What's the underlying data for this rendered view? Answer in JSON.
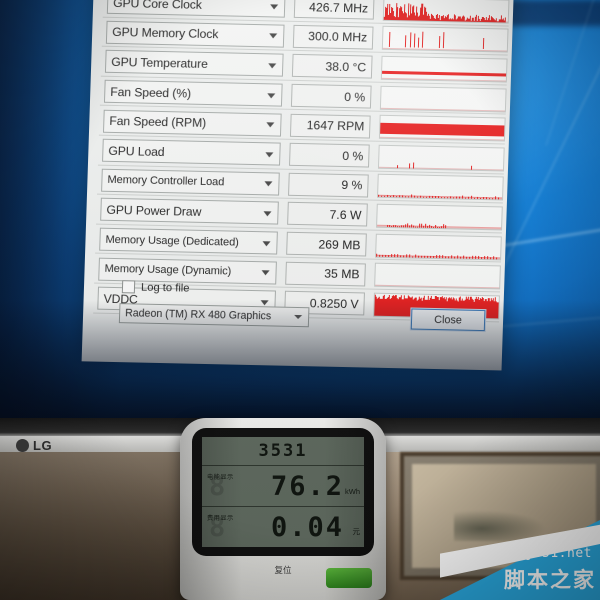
{
  "scene": {
    "monitor_brand": "LG",
    "watermark_latin": "jb51.net",
    "watermark_cn": "脚本之家"
  },
  "dialog": {
    "rows": [
      {
        "name": "GPU Core Clock",
        "value": "426.7 MHz",
        "graph": "spiky"
      },
      {
        "name": "GPU Memory Clock",
        "value": "300.0 MHz",
        "graph": "sparse"
      },
      {
        "name": "GPU Temperature",
        "value": "38.0 °C",
        "graph": "line-high"
      },
      {
        "name": "Fan Speed (%)",
        "value": "0 %",
        "graph": "empty"
      },
      {
        "name": "Fan Speed (RPM)",
        "value": "1647 RPM",
        "graph": "thickbar"
      },
      {
        "name": "GPU Load",
        "value": "0 %",
        "graph": "dots"
      },
      {
        "name": "Memory Controller Load",
        "value": "9 %",
        "graph": "flat"
      },
      {
        "name": "GPU Power Draw",
        "value": "7.6 W",
        "graph": "lowbump"
      },
      {
        "name": "Memory Usage (Dedicated)",
        "value": "269 MB",
        "graph": "flat"
      },
      {
        "name": "Memory Usage (Dynamic)",
        "value": "35 MB",
        "graph": "empty"
      },
      {
        "name": "VDDC",
        "value": "0.8250 V",
        "graph": "solid"
      }
    ],
    "log_to_file_label": "Log to file",
    "gpu_select_value": "Radeon (TM) RX 480 Graphics",
    "close_label": "Close",
    "accent_graph_color": "#ef1f1f",
    "focus_border_color": "#3d7ec0"
  },
  "meter": {
    "top_reading": "3531",
    "energy_label_cn": "电能显示",
    "energy_value": "76.2",
    "energy_unit": "kWh",
    "cost_label_cn": "费用显示",
    "cost_value": "0.04",
    "cost_unit": "元",
    "reset_label_cn": "复位"
  }
}
